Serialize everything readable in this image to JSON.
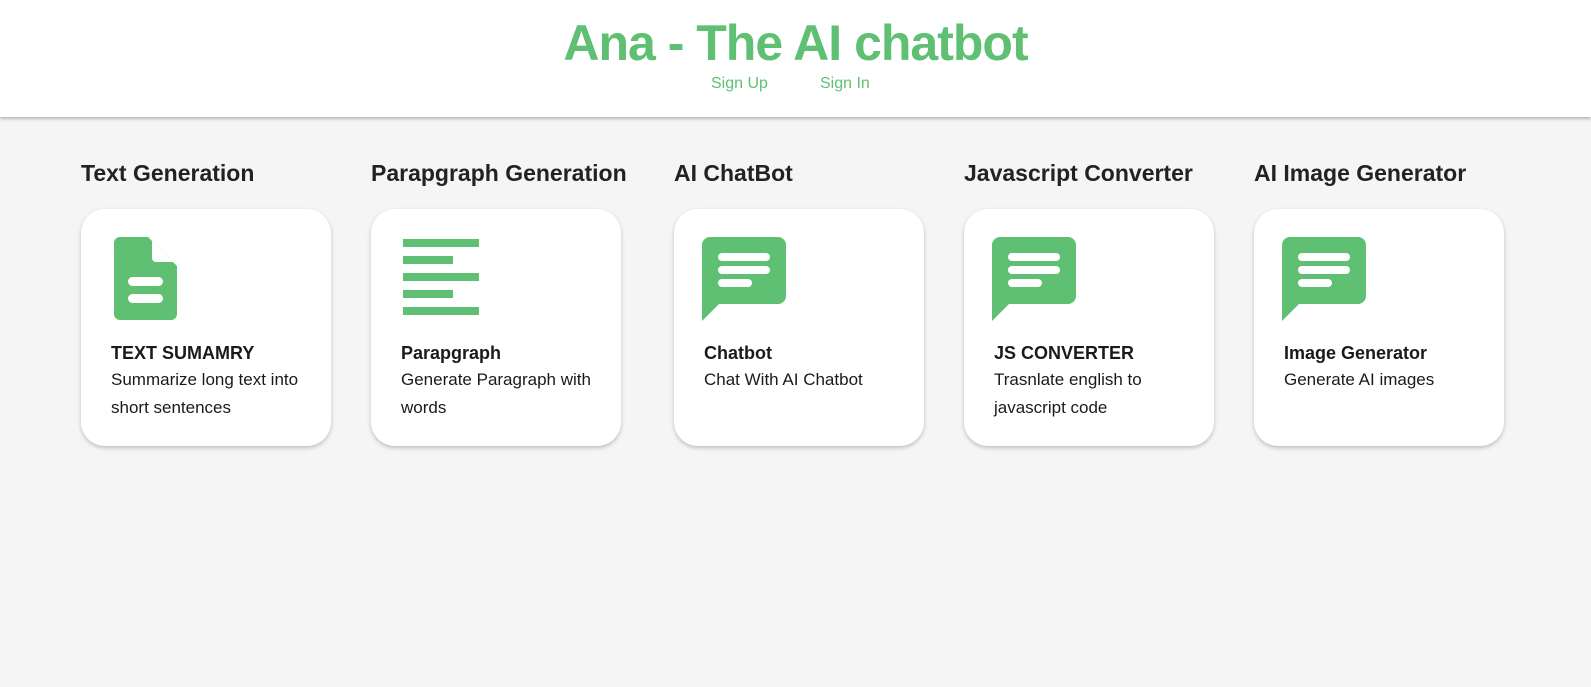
{
  "header": {
    "title": "Ana - The AI chatbot",
    "nav": {
      "sign_up": "Sign Up",
      "sign_in": "Sign In"
    }
  },
  "accent_color": "#5fbf72",
  "tools": [
    {
      "heading": "Text Generation",
      "card_title": "TEXT SUMAMRY",
      "card_desc": "Summarize long text into short sentences",
      "icon": "document-icon"
    },
    {
      "heading": "Parapgraph Generation",
      "card_title": "Parapgraph",
      "card_desc": "Generate Paragraph with words",
      "icon": "paragraph-lines-icon"
    },
    {
      "heading": "AI ChatBot",
      "card_title": "Chatbot",
      "card_desc": "Chat With AI Chatbot",
      "icon": "chat-bubble-icon"
    },
    {
      "heading": "Javascript Converter",
      "card_title": "JS CONVERTER",
      "card_desc": "Trasnlate english to javascript code",
      "icon": "chat-bubble-icon"
    },
    {
      "heading": "AI Image Generator",
      "card_title": "Image Generator",
      "card_desc": "Generate AI images",
      "icon": "chat-bubble-icon"
    }
  ]
}
